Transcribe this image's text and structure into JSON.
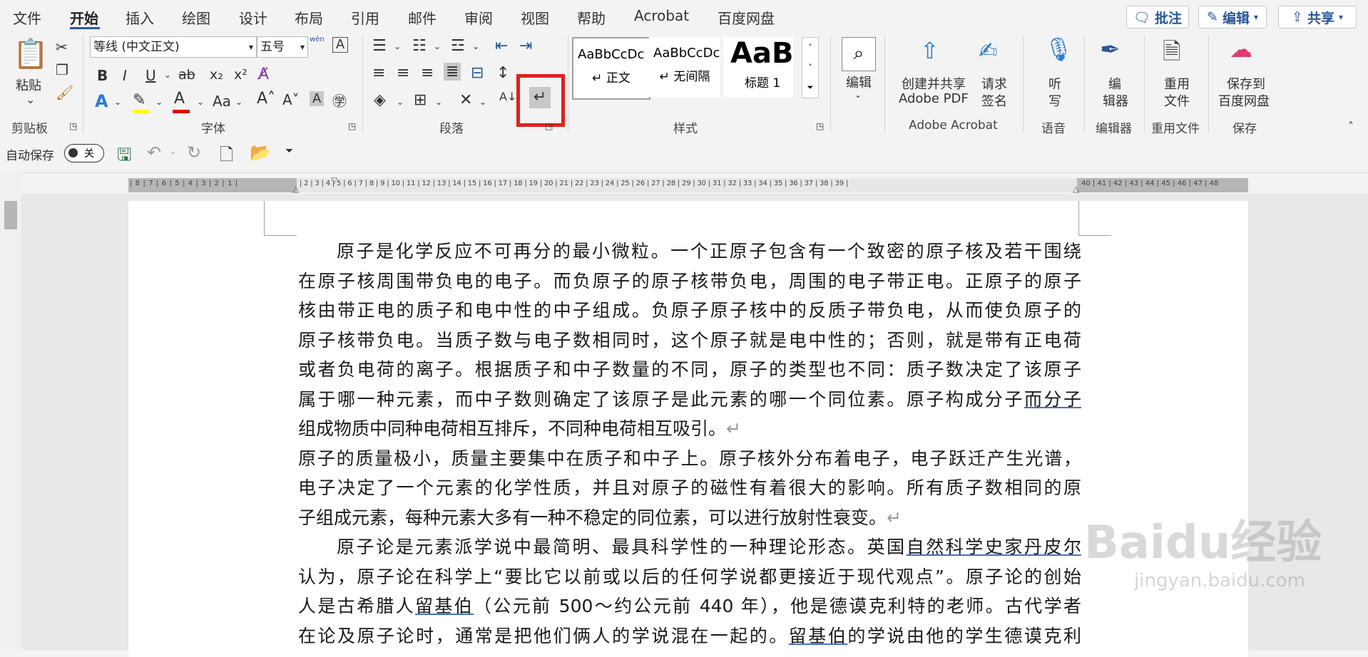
{
  "menu": {
    "tabs": [
      "文件",
      "开始",
      "插入",
      "绘图",
      "设计",
      "布局",
      "引用",
      "邮件",
      "审阅",
      "视图",
      "帮助",
      "Acrobat",
      "百度网盘"
    ],
    "active_tab": "开始",
    "comment_btn": "批注",
    "edit_btn": "编辑",
    "share_btn": "共享"
  },
  "ribbon": {
    "clipboard": {
      "paste": "粘贴",
      "label": "剪贴板"
    },
    "font": {
      "family": "等线 (中文正文)",
      "size": "五号",
      "label": "字体",
      "wen": "wén"
    },
    "paragraph": {
      "label": "段落"
    },
    "styles": {
      "items": [
        {
          "preview": "AaBbCcDc",
          "name": "正文"
        },
        {
          "preview": "AaBbCcDc",
          "name": "无间隔"
        },
        {
          "preview": "AaBl",
          "name": "标题 1"
        }
      ],
      "label": "样式"
    },
    "editing": {
      "label": "编辑"
    },
    "adobe": {
      "create_share_1": "创建并共享",
      "create_share_2": "Adobe PDF",
      "request_sign_1": "请求",
      "request_sign_2": "签名",
      "label": "Adobe Acrobat"
    },
    "voice": {
      "listen_1": "听",
      "listen_2": "写",
      "label": "语音"
    },
    "editor": {
      "name_1": "编",
      "name_2": "辑器",
      "label": "编辑器"
    },
    "reuse": {
      "name_1": "重用",
      "name_2": "文件",
      "label": "重用文件"
    },
    "save": {
      "name_1": "保存到",
      "name_2": "百度网盘",
      "label": "保存"
    }
  },
  "qat": {
    "autosave": "自动保存",
    "toggle": "关"
  },
  "ruler": {
    "left_numbers": "| 8 | 7 | 6 | 5 | 4 | 3 | 2 | 1 |",
    "right_numbers": "| 2 | 3 | 4 | 5 | 6 | 7 | 8 | 9 | 10 | 11 | 12 | 13 | 14 | 15 | 16 | 17 | 18 | 19 | 20 | 21 | 22 | 23 | 24 | 25 | 26 | 27 | 28 | 29 | 30 | 31 | 32 | 33 | 34 | 35 | 36 | 37 | 38 | 39 |",
    "end_numbers": "40 | 41 | 42 | 43 | 44 | 45 | 46 | 47 | 48"
  },
  "document": {
    "p1": [
      "原子是化学反应不可再分的最小微粒。一个正原子包含有一个致密的原子核及若干围绕",
      "在原子核周围带负电的电子。而负原子的原子核带负电，周围的电子带正电。正原子的原子",
      "核由带正电的质子和电中性的中子组成。负原子原子核中的反质子带负电，从而使负原子的",
      "原子核带负电。当质子数与电子数相同时，这个原子就是电中性的；否则，就是带有正电荷",
      "或者负电荷的离子。根据质子和中子数量的不同，原子的类型也不同：质子数决定了该原子",
      "属于哪一种元素，而中子数则确定了该原子是此元素的哪一个同位素。原子构成分子",
      "而分子",
      "组成物质中同种电荷相互排斥，不同种电荷相互吸引。"
    ],
    "p2": [
      "原子的质量极小，质量主要集中在质子和中子上。原子核外分布着电子，电子跃迁产生光谱，",
      "电子决定了一个元素的化学性质，并且对原子的磁性有着很大的影响。所有质子数相同的原",
      "子组成元素，每种元素大多有一种不稳定的同位素，可以进行放射性衰变。"
    ],
    "p3": [
      "原子论是元素派学说中最简明、最具科学性的一种理论形态。英国",
      "自然科学史家丹皮尔",
      "认为，原子论在科学上“要比它以前或以后的任何学说都更接近于现代观点”。原子论的创始",
      "人是古希腊人",
      "留基伯",
      "（公元前 500～约公元前 440 年），他是德谟克利特的老师。古代学者",
      "在论及原子论时，通常是把他们俩人的学说混在一起的。",
      "的学说由他的学生德谟克利"
    ],
    "mark": "↵"
  },
  "watermark": {
    "brand": "Baidu经验",
    "url": "jingyan.baidu.com"
  }
}
